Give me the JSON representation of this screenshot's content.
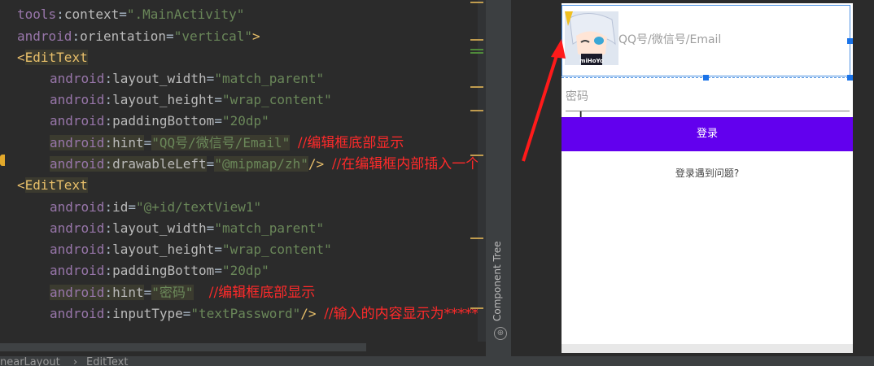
{
  "editor": {
    "lines": [
      {
        "ns": "tools",
        "name": "context",
        "value": "\".MainActivity\""
      },
      {
        "ns": "android",
        "name": "orientation",
        "value": "\"vertical\"",
        "close": ">"
      },
      {
        "tag": "EditText"
      },
      {
        "ns": "android",
        "name": "layout_width",
        "value": "\"match_parent\""
      },
      {
        "ns": "android",
        "name": "layout_height",
        "value": "\"wrap_content\""
      },
      {
        "ns": "android",
        "name": "paddingBottom",
        "value": "\"20dp\""
      },
      {
        "ns": "android",
        "name": "hint",
        "value": "\"QQ号/微信号/Email\"",
        "comment": "//编辑框底部显示"
      },
      {
        "ns": "android",
        "name": "drawableLeft",
        "value": "\"@mipmap/zh\"",
        "close": "/>",
        "comment": "//在编辑框内部插入一个图片"
      },
      {
        "tag": "EditText"
      },
      {
        "ns": "android",
        "name": "id",
        "value": "\"@+id/textView1\""
      },
      {
        "ns": "android",
        "name": "layout_width",
        "value": "\"match_parent\""
      },
      {
        "ns": "android",
        "name": "layout_height",
        "value": "\"wrap_content\""
      },
      {
        "ns": "android",
        "name": "paddingBottom",
        "value": "\"20dp\""
      },
      {
        "ns": "android",
        "name": "hint",
        "value": "\"密码\"",
        "comment": "//编辑框底部显示"
      },
      {
        "ns": "android",
        "name": "inputType",
        "value": "\"textPassword\"",
        "close": "/>",
        "comment": "//输入的内容显示为*****"
      }
    ]
  },
  "side_panel": {
    "label": "Component Tree"
  },
  "preview": {
    "account_hint": "QQ号/微信号/Email",
    "avatar_label": "miHoYo",
    "password_hint": "密码",
    "login_button": "登录",
    "help_link": "登录遇到问题?"
  },
  "statusbar": {
    "left": "nearLayout",
    "separator": "›",
    "right": "EditText"
  },
  "colors": {
    "accent": "#6200ee",
    "annotation": "#ff2a2a",
    "selection": "#4a90e2"
  }
}
